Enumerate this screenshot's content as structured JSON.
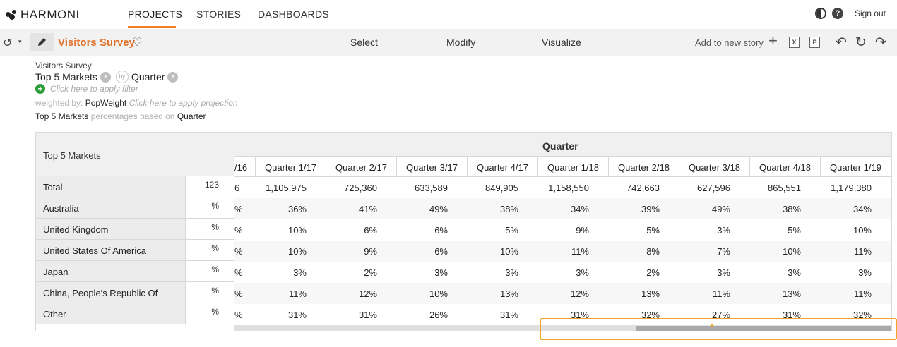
{
  "app": {
    "logo": "HARMONI",
    "nav": [
      "PROJECTS",
      "STORIES",
      "DASHBOARDS"
    ],
    "active_nav": "PROJECTS",
    "signout": "Sign out",
    "help_glyph": "?",
    "accent_color": "#f08020"
  },
  "toolbar": {
    "title": "Visitors Survey",
    "tabs": [
      "Select",
      "Modify",
      "Visualize"
    ],
    "add_to_story": "Add to new story",
    "excel_glyph": "X",
    "ppt_glyph": "P"
  },
  "info": {
    "survey": "Visitors Survey",
    "row_var": "Top 5 Markets",
    "by_label": "by",
    "col_var": "Quarter",
    "filter_hint": "Click here to apply filter",
    "weight_prefix": "weighted by:",
    "weight_var": "PopWeight",
    "projection_hint": "Click here to apply projection",
    "pct_var": "Top 5 Markets",
    "pct_mid": "percentages based on",
    "pct_base": "Quarter"
  },
  "table": {
    "row_header": "Top 5 Markets",
    "col_group": "Quarter",
    "partial_col_head": "/16",
    "columns": [
      "Quarter 1/17",
      "Quarter 2/17",
      "Quarter 3/17",
      "Quarter 4/17",
      "Quarter 1/18",
      "Quarter 2/18",
      "Quarter 3/18",
      "Quarter 4/18",
      "Quarter 1/19"
    ],
    "rows": [
      {
        "label": "Total",
        "unit": "123",
        "partial": "6",
        "values": [
          "1,105,975",
          "725,360",
          "633,589",
          "849,905",
          "1,158,550",
          "742,663",
          "627,596",
          "865,551",
          "1,179,380"
        ]
      },
      {
        "label": "Australia",
        "unit": "%",
        "partial": "%",
        "values": [
          "36%",
          "41%",
          "49%",
          "38%",
          "34%",
          "39%",
          "49%",
          "38%",
          "34%"
        ]
      },
      {
        "label": "United Kingdom",
        "unit": "%",
        "partial": "%",
        "values": [
          "10%",
          "6%",
          "6%",
          "5%",
          "9%",
          "5%",
          "3%",
          "5%",
          "10%"
        ]
      },
      {
        "label": "United States Of America",
        "unit": "%",
        "partial": "%",
        "values": [
          "10%",
          "9%",
          "6%",
          "10%",
          "11%",
          "8%",
          "7%",
          "10%",
          "11%"
        ]
      },
      {
        "label": "Japan",
        "unit": "%",
        "partial": "%",
        "values": [
          "3%",
          "2%",
          "3%",
          "3%",
          "3%",
          "2%",
          "3%",
          "3%",
          "3%"
        ]
      },
      {
        "label": "China, People's Republic Of",
        "unit": "%",
        "partial": "%",
        "values": [
          "11%",
          "12%",
          "10%",
          "13%",
          "12%",
          "13%",
          "11%",
          "13%",
          "11%"
        ]
      },
      {
        "label": "Other",
        "unit": "%",
        "partial": "%",
        "values": [
          "31%",
          "31%",
          "26%",
          "31%",
          "31%",
          "32%",
          "27%",
          "31%",
          "32%"
        ]
      }
    ]
  }
}
